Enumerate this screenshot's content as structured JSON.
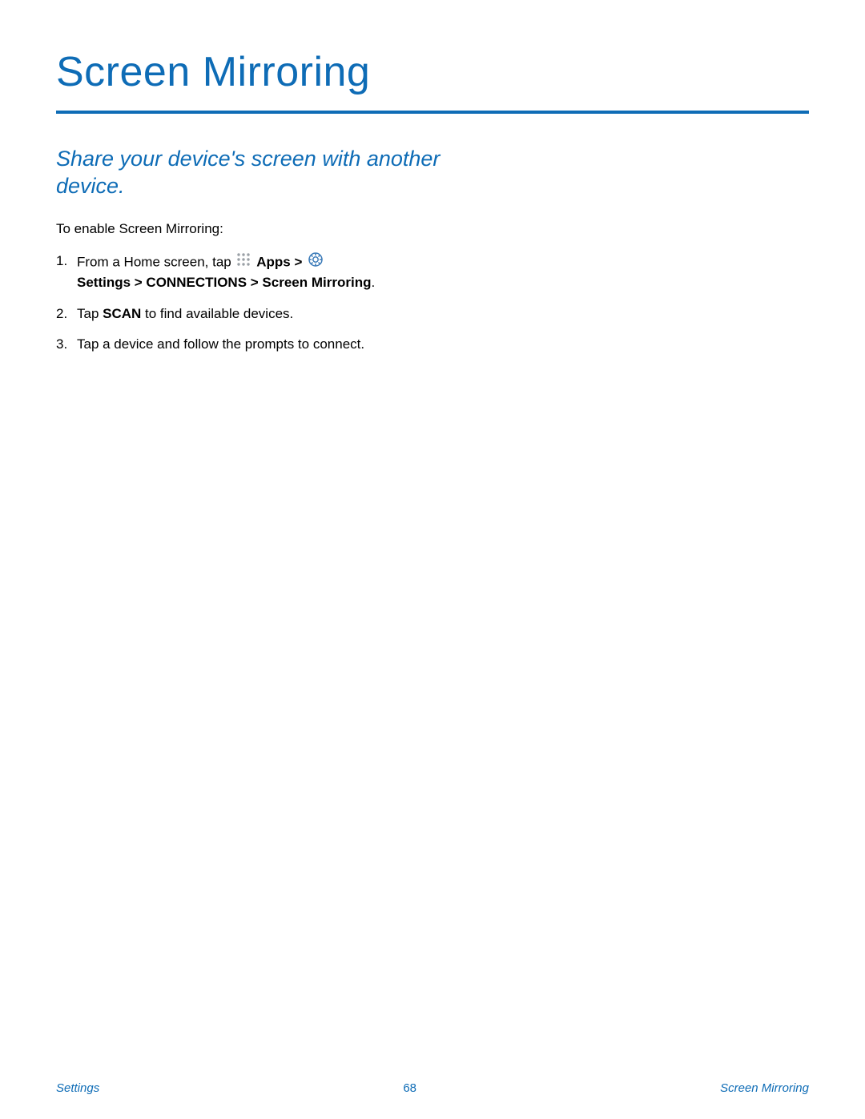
{
  "title": "Screen Mirroring",
  "subtitle": "Share your device's screen with another device.",
  "intro": "To enable Screen Mirroring:",
  "steps": [
    {
      "num": "1.",
      "pre": "From a Home screen, tap ",
      "icon1": "apps-grid-icon",
      "bold1": "Apps",
      "sep": " > ",
      "icon2": "settings-gear-icon",
      "line2_bold": "Settings > CONNECTIONS > Screen Mirroring",
      "line2_after": "."
    },
    {
      "num": "2.",
      "pre": "Tap ",
      "bold1": "SCAN",
      "after": " to find available devices."
    },
    {
      "num": "3.",
      "pre": "Tap a device and follow the prompts to connect."
    }
  ],
  "footer": {
    "left": "Settings",
    "center": "68",
    "right": "Screen Mirroring"
  },
  "colors": {
    "accent": "#0e6cb6"
  }
}
